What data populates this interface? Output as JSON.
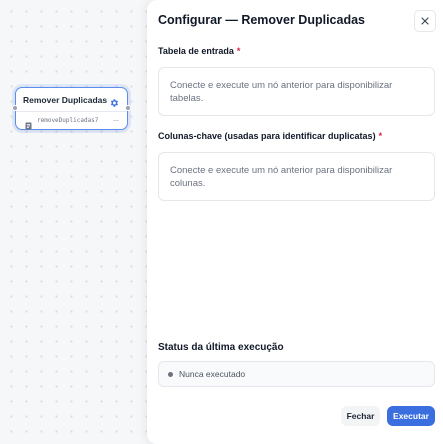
{
  "canvas": {
    "node": {
      "title": "Remover Duplicadas",
      "id_label": "removeDuplicadas7",
      "trailing": "—",
      "icons": {
        "settings": "gear-icon",
        "type": "file-icon"
      }
    }
  },
  "panel": {
    "title": "Configurar — Remover Duplicadas",
    "close_icon": "close-icon",
    "input_table": {
      "label": "Tabela de entrada",
      "required_mark": "*",
      "placeholder": "Conecte e execute um nó anterior para disponibilizar tabelas."
    },
    "key_columns": {
      "label": "Colunas-chave (usadas para identificar duplicatas)",
      "required_mark": "*",
      "placeholder": "Conecte e execute um nó anterior para disponibilizar colunas."
    },
    "last_run": {
      "title": "Status da última execução",
      "status": "Nunca executado"
    },
    "buttons": {
      "close": "Fechar",
      "run": "Executar"
    }
  },
  "colors": {
    "accent": "#3b6fe0",
    "node_border": "#5b8def",
    "required": "#e11d48"
  }
}
